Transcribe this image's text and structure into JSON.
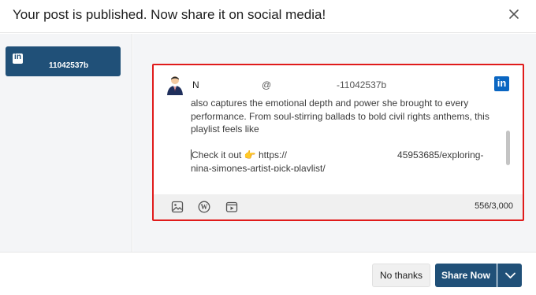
{
  "dialog": {
    "title": "Your post is published. Now share it on social media!",
    "close_icon": "close-icon"
  },
  "sidebar": {
    "accounts": [
      {
        "network": "LinkedIn",
        "icon": "linkedin-icon",
        "name": "11042537b",
        "selected": true
      }
    ]
  },
  "preview": {
    "highlight_color": "#e01b1b",
    "author": {
      "avatar_icon": "user-avatar-icon",
      "name": "N",
      "at": "@",
      "handle": "-11042537b"
    },
    "network_logo": "linkedin-logo-icon",
    "body": {
      "line1": "also captures the emotional depth and power she brought to every",
      "line2": "performance. From soul-stirring ballads to bold civil rights anthems, this",
      "line3": "playlist feels like",
      "link_line1": "Check it out 👉 https://                                          45953685/exploring-",
      "link_line2": "nina-simones-artist-pick-playlist/"
    },
    "toolbar": {
      "image_icon": "image-icon",
      "wordpress_icon": "wordpress-icon",
      "media_icon": "media-icon"
    },
    "char_count": "556/3,000"
  },
  "footer": {
    "no_thanks": "No thanks",
    "share_now": "Share Now",
    "dropdown_icon": "chevron-down-icon",
    "brand_color": "#205078"
  }
}
